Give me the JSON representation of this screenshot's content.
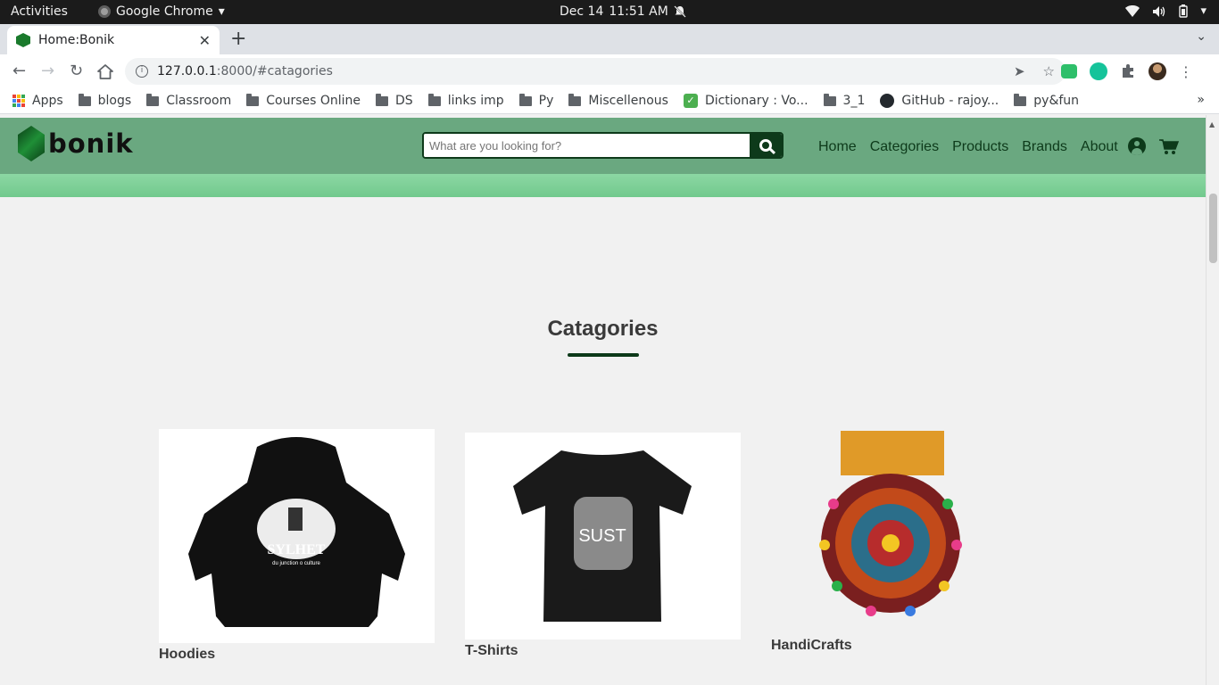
{
  "os_bar": {
    "activities": "Activities",
    "app_name": "Google Chrome",
    "date": "Dec 14",
    "time": "11:51 AM"
  },
  "browser": {
    "tab_title": "Home:Bonik",
    "url_host": "127.0.0.1",
    "url_path": ":8000/#catagories",
    "bookmarks": [
      "Apps",
      "blogs",
      "Classroom",
      "Courses Online",
      "DS",
      "links imp",
      "Py",
      "Miscellenous",
      "Dictionary : Vo...",
      "3_1",
      "GitHub - rajoy...",
      "py&fun"
    ]
  },
  "site": {
    "logo_text": "bonik",
    "search_placeholder": "What are you looking for?",
    "nav": [
      "Home",
      "Categories",
      "Products",
      "Brands",
      "About"
    ],
    "section_title": "Catagories",
    "categories": [
      {
        "name": "Hoodies",
        "print_title": "SYLHET",
        "print_subtitle": "du junction o culture"
      },
      {
        "name": "T-Shirts",
        "print_title": "SUST"
      },
      {
        "name": "HandiCrafts"
      }
    ]
  },
  "colors": {
    "header_green": "#6aa880",
    "strip_green": "#8cd7a3",
    "dark_green": "#0d3a1a"
  }
}
